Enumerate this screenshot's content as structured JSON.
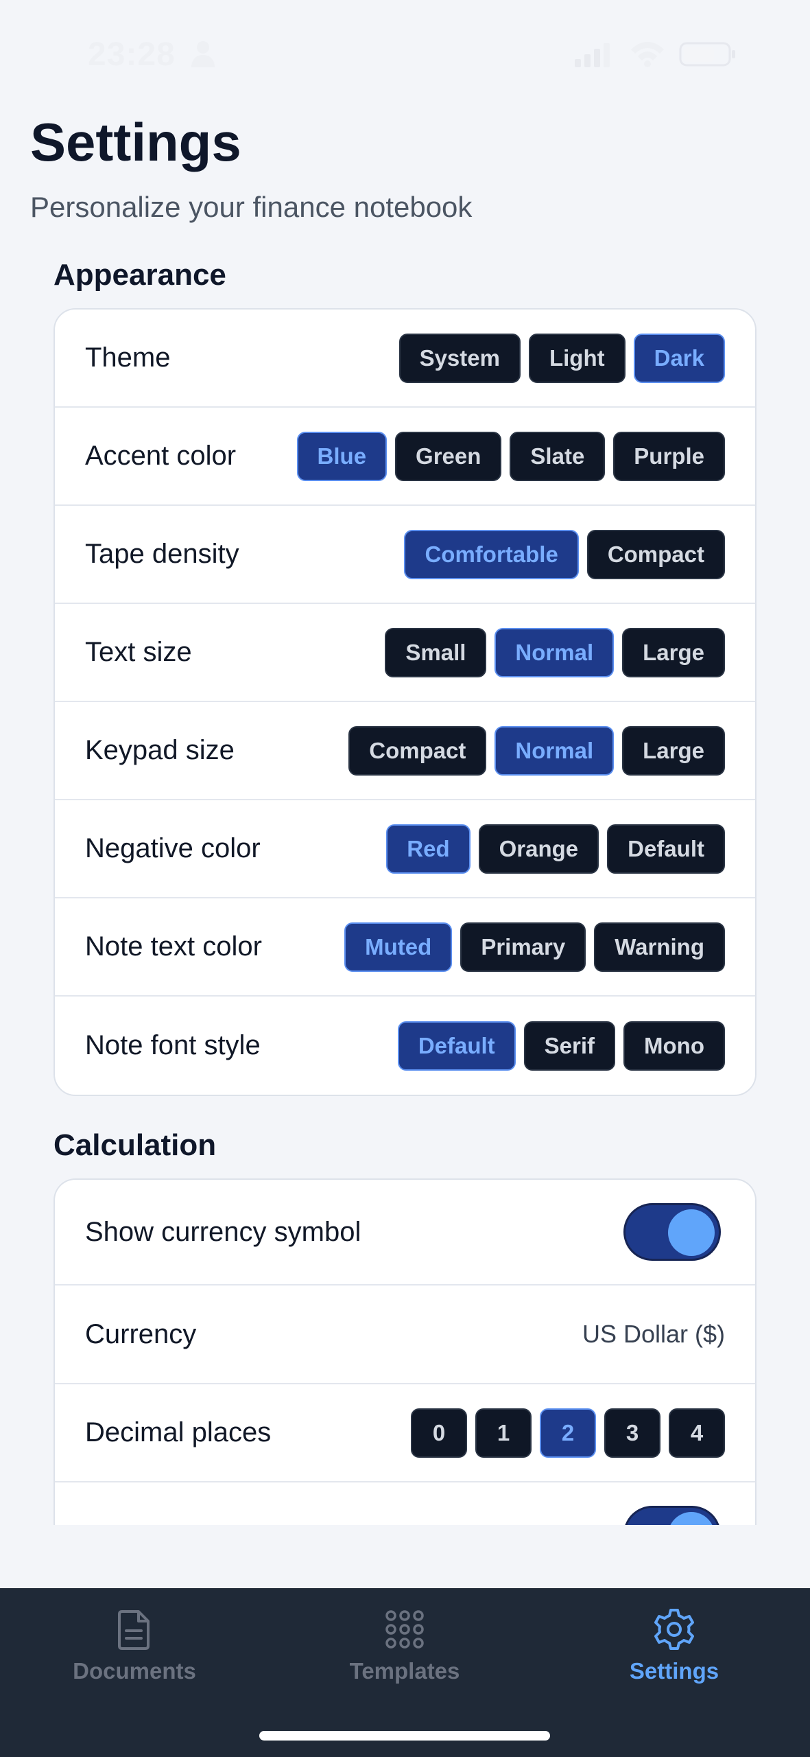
{
  "status_bar": {
    "time": "23:28"
  },
  "header": {
    "title": "Settings",
    "subtitle": "Personalize your finance notebook"
  },
  "appearance": {
    "section_title": "Appearance",
    "rows": [
      {
        "label": "Theme",
        "options": [
          "System",
          "Light",
          "Dark"
        ],
        "selected": "Dark"
      },
      {
        "label": "Accent color",
        "options": [
          "Blue",
          "Green",
          "Slate",
          "Purple"
        ],
        "selected": "Blue"
      },
      {
        "label": "Tape density",
        "options": [
          "Comfortable",
          "Compact"
        ],
        "selected": "Comfortable"
      },
      {
        "label": "Text size",
        "options": [
          "Small",
          "Normal",
          "Large"
        ],
        "selected": "Normal"
      },
      {
        "label": "Keypad size",
        "options": [
          "Compact",
          "Normal",
          "Large"
        ],
        "selected": "Normal"
      },
      {
        "label": "Negative color",
        "options": [
          "Red",
          "Orange",
          "Default"
        ],
        "selected": "Red"
      },
      {
        "label": "Note text color",
        "options": [
          "Muted",
          "Primary",
          "Warning"
        ],
        "selected": "Muted"
      },
      {
        "label": "Note font style",
        "options": [
          "Default",
          "Serif",
          "Mono"
        ],
        "selected": "Default"
      }
    ]
  },
  "calculation": {
    "section_title": "Calculation",
    "show_currency_symbol": {
      "label": "Show currency symbol",
      "enabled": true
    },
    "currency": {
      "label": "Currency",
      "value": "US Dollar ($)"
    },
    "decimal_places": {
      "label": "Decimal places",
      "options": [
        "0",
        "1",
        "2",
        "3",
        "4"
      ],
      "selected": "2"
    },
    "partial_row": {
      "enabled": true
    }
  },
  "tab_bar": {
    "tabs": [
      {
        "label": "Documents",
        "icon": "document-icon",
        "active": false
      },
      {
        "label": "Templates",
        "icon": "grid-icon",
        "active": false
      },
      {
        "label": "Settings",
        "icon": "gear-icon",
        "active": true
      }
    ]
  },
  "colors": {
    "accent": "#60a5fa",
    "selected_bg": "#1e3a8a",
    "chip_bg": "#0f1726",
    "tab_bar_bg": "#1f2937"
  }
}
